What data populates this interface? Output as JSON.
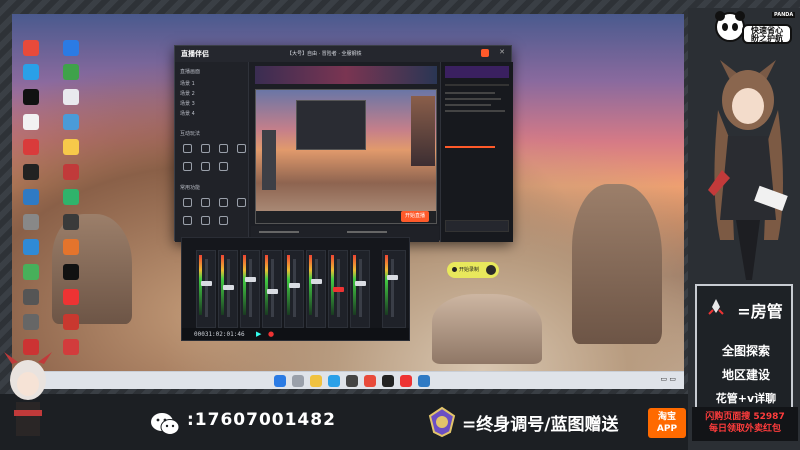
{
  "live_window": {
    "logo": "直播伴侣",
    "stream_title": "【大号】自由 · 冒险者 · 全服钢铁",
    "start_live_label": "开始直播",
    "left_panel_labels": [
      "直播画面",
      "场景 1",
      "场景 2",
      "场景 3",
      "场景 4",
      "互动玩法",
      "常用功能"
    ]
  },
  "mixer": {
    "timecode": "00031:02:01:46",
    "channel_count": 10
  },
  "recorder": {
    "label": "开始录制"
  },
  "right_panel": {
    "panda_tag": "PANDA",
    "badge_line1": "快速省心",
    "badge_line2": "盼之护航",
    "role_lines": [
      "=房管",
      "全图探索",
      "地区建设",
      "花管+v详聊"
    ]
  },
  "bottom": {
    "phone": ":17607001482",
    "slogan": "=终身调号/蓝图赠送",
    "taobao_line1": "淘宝",
    "taobao_line2": "APP",
    "promo_line1": "闪购页面搜 52987",
    "promo_line2": "每日领取外卖红包"
  },
  "colors": {
    "accent_orange": "#ff5a2a",
    "recorder_yellow": "#e8e85c",
    "taobao": "#ff6a00",
    "promo_red": "#ff3c3c"
  }
}
